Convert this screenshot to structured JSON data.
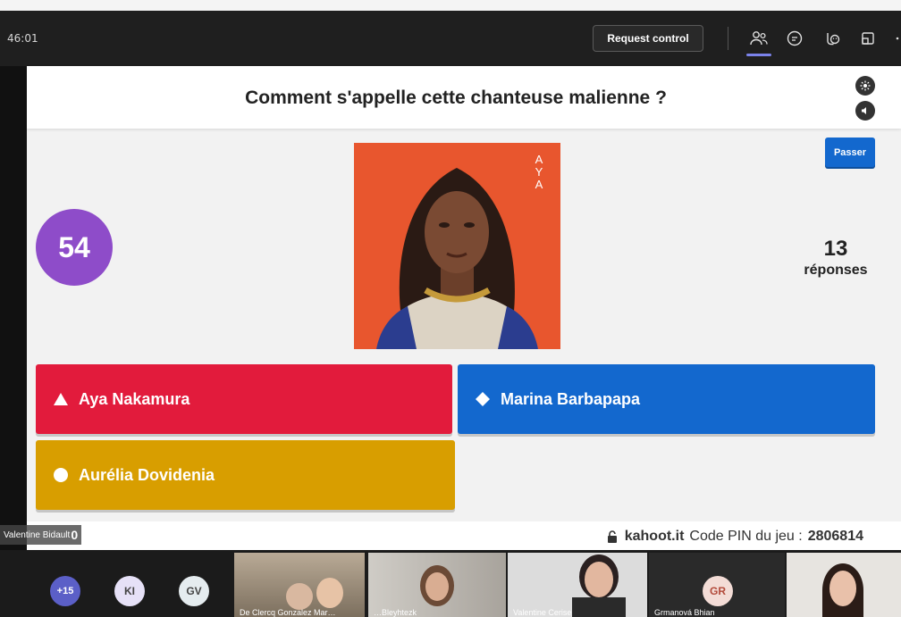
{
  "toolbar": {
    "timer": "46:01",
    "request_control": "Request control"
  },
  "slide": {
    "question": "Comment s'appelle cette chanteuse malienne ?",
    "countdown": "54",
    "skip_label": "Passer",
    "answers_count": "13",
    "answers_label": "réponses",
    "photo_text": "AYA",
    "answers": [
      {
        "label": "Aya Nakamura",
        "color": "#e21b3c",
        "shape": "triangle"
      },
      {
        "label": "Marina Barbapapa",
        "color": "#1368ce",
        "shape": "diamond"
      },
      {
        "label": "Aurélia Dovidenia",
        "color": "#d89e00",
        "shape": "circle"
      }
    ],
    "footer": {
      "brand": "kahoot.it",
      "pin_label": "Code PIN du jeu :",
      "pin": "2806814",
      "presenter_name": "Valentine Bidault",
      "score": "0"
    }
  },
  "participants": {
    "avatars": [
      {
        "initials": "+15"
      },
      {
        "initials": "KI"
      },
      {
        "initials": "GV"
      }
    ],
    "tiles": [
      {
        "name": "De Clercq Gonzalez Mar…"
      },
      {
        "name": "…Bleyhtezk"
      },
      {
        "name": "Valentine Cerise"
      },
      {
        "initials": "GR",
        "name": "Grmanová Bhian"
      },
      {
        "name": ""
      }
    ]
  },
  "colors": {
    "accent": "#7b83eb",
    "timer_circle": "#8e4cc9",
    "skip": "#1368ce"
  }
}
